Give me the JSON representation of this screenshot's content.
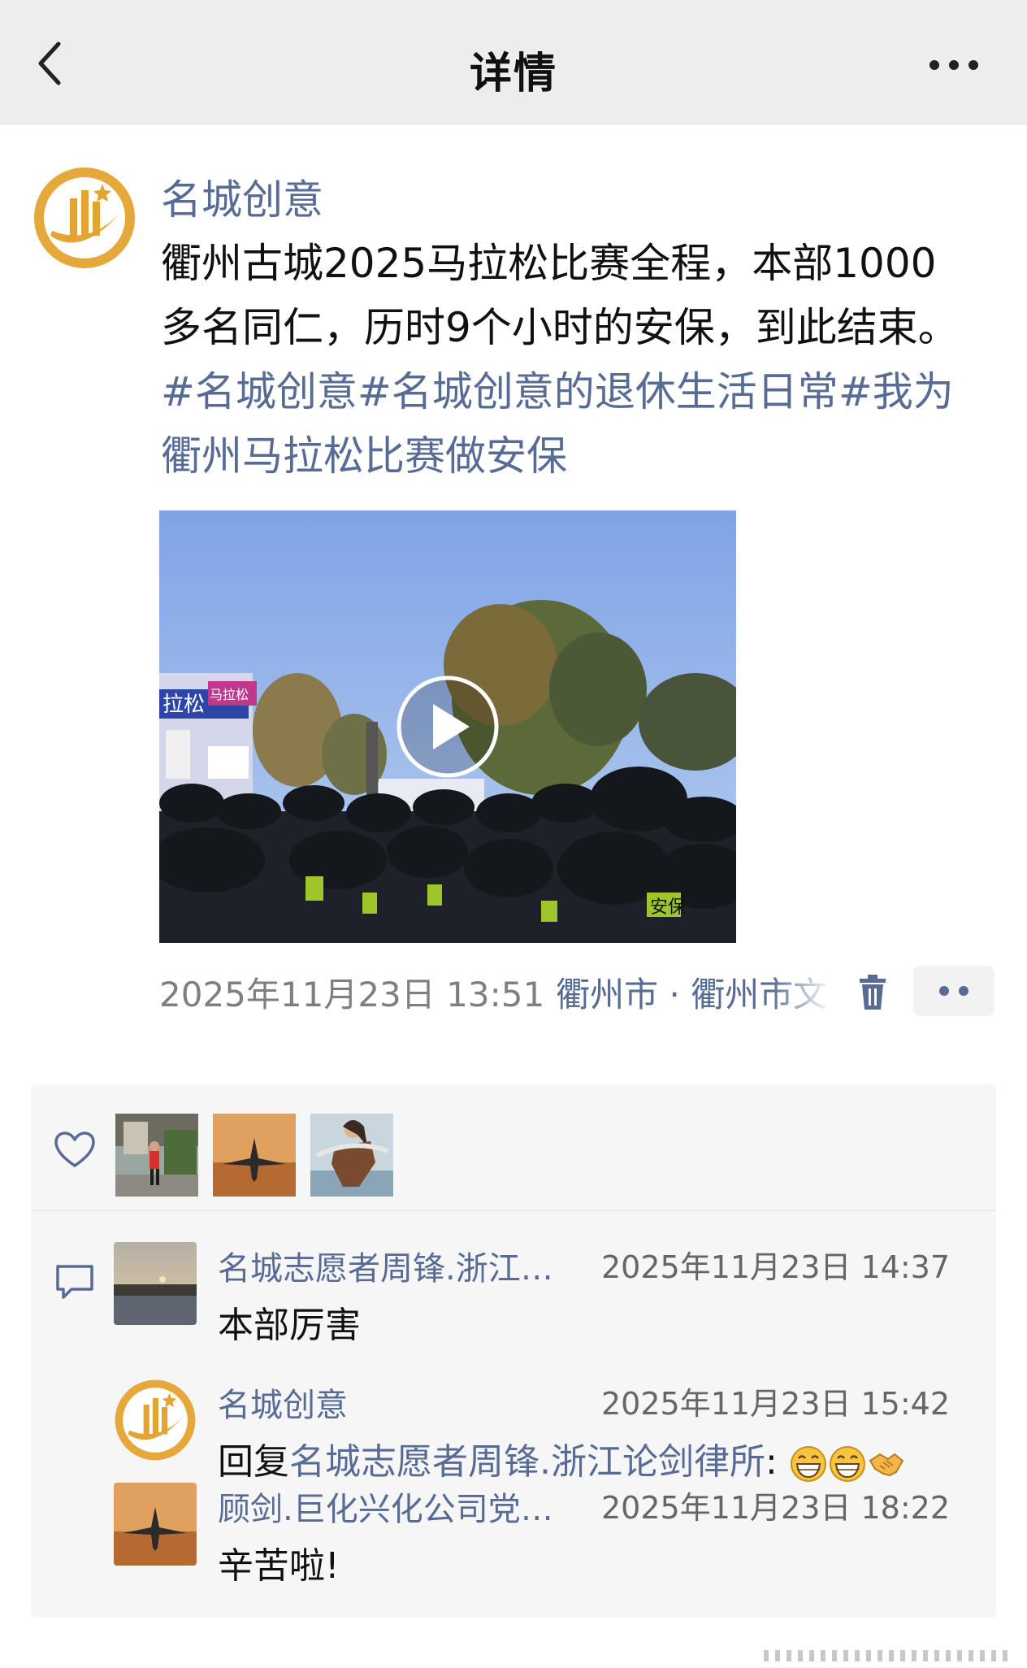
{
  "header": {
    "title": "详情"
  },
  "post": {
    "author": "名城创意",
    "text_line1": "衢州古城2025马拉松比赛全程，本部1000",
    "text_line2": "多名同仁，历时9个小时的安保，到此结束。",
    "tags": [
      "#名城创意",
      "#名城创意的退休生活日常",
      "#我为",
      "衢州马拉松比赛做安保"
    ],
    "video_signs": {
      "banner1": "拉松",
      "banner2": "马拉松",
      "vest": "安保"
    },
    "timestamp": "2025年11月23日 13:51",
    "location": "衢州市 · 衢州市文"
  },
  "likes": {
    "avatars": [
      "person-photo",
      "jet-photo",
      "warrior-photo"
    ]
  },
  "comments": [
    {
      "name": "名城志愿者周锋.浙江…",
      "time": "2025年11月23日 14:37",
      "text": "本部厉害"
    },
    {
      "name": "名城创意",
      "time": "2025年11月23日 15:42",
      "reply_prefix": "回复",
      "reply_target": "名城志愿者周锋.浙江论剑律所",
      "reply_colon": ":",
      "emojis": [
        "grin",
        "grin",
        "handshake"
      ]
    },
    {
      "name": "顾剑.巨化兴化公司党…",
      "time": "2025年11月23日 18:22",
      "text": "辛苦啦!"
    }
  ],
  "colors": {
    "link": "#576b95",
    "header_bg": "#ededed",
    "panel_bg": "#f6f6f6",
    "logo_gold": "#e3a434"
  }
}
